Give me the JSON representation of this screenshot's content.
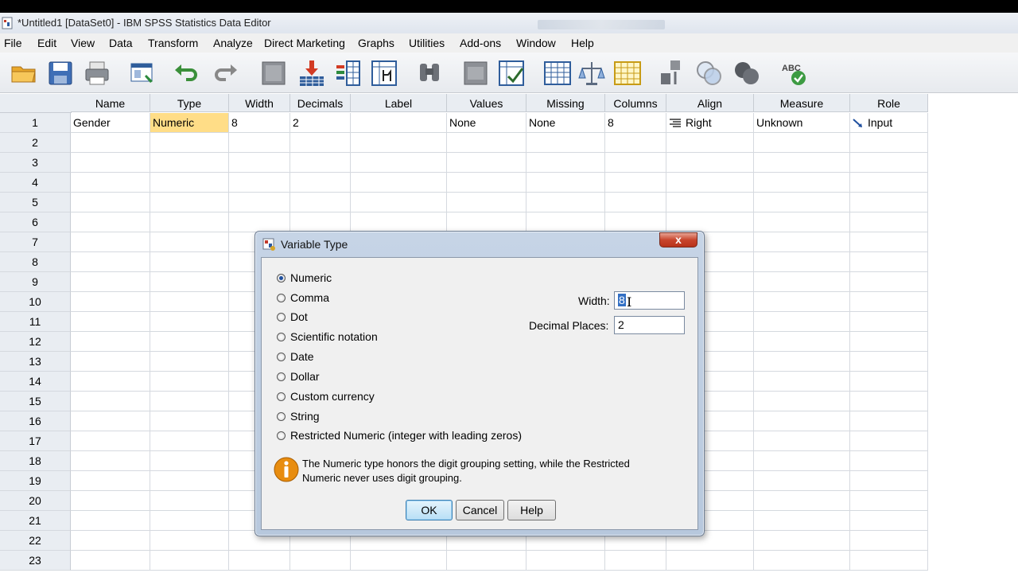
{
  "window": {
    "title": "*Untitled1 [DataSet0] - IBM SPSS Statistics Data Editor"
  },
  "menu": [
    "File",
    "Edit",
    "View",
    "Data",
    "Transform",
    "Analyze",
    "Direct Marketing",
    "Graphs",
    "Utilities",
    "Add-ons",
    "Window",
    "Help"
  ],
  "toolbar": {
    "icons": [
      "open-folder-icon",
      "save-icon",
      "print-icon",
      "dialog-recall-icon",
      "undo-icon",
      "redo-icon",
      "goto-case-icon",
      "goto-variable-icon",
      "variables-icon",
      "run-descriptives-icon",
      "find-icon",
      "insert-cases-icon",
      "insert-variable-icon",
      "split-file-icon",
      "weight-cases-icon",
      "select-cases-icon",
      "value-labels-icon",
      "use-sets-icon",
      "show-all-variables-icon",
      "spell-check-icon"
    ],
    "spell_label": "ABC"
  },
  "grid": {
    "columns": [
      "Name",
      "Type",
      "Width",
      "Decimals",
      "Label",
      "Values",
      "Missing",
      "Columns",
      "Align",
      "Measure",
      "Role"
    ],
    "rows": [
      {
        "num": "1",
        "cells": [
          "Gender",
          "Numeric",
          "8",
          "2",
          "",
          "None",
          "None",
          "8",
          "Right",
          "Unknown",
          "Input"
        ]
      }
    ],
    "row_numbers": [
      "1",
      "2",
      "3",
      "4",
      "5",
      "6",
      "7",
      "8",
      "9",
      "10",
      "11",
      "12",
      "13",
      "14",
      "15",
      "16",
      "17",
      "18",
      "19",
      "20",
      "21",
      "22",
      "23"
    ]
  },
  "dialog": {
    "title": "Variable Type",
    "close": "x",
    "types": [
      {
        "label": "Numeric",
        "selected": true
      },
      {
        "label": "Comma",
        "selected": false
      },
      {
        "label": "Dot",
        "selected": false
      },
      {
        "label": "Scientific notation",
        "selected": false
      },
      {
        "label": "Date",
        "selected": false
      },
      {
        "label": "Dollar",
        "selected": false
      },
      {
        "label": "Custom currency",
        "selected": false
      },
      {
        "label": "String",
        "selected": false
      },
      {
        "label": "Restricted Numeric (integer with leading zeros)",
        "selected": false
      }
    ],
    "width_label": "Width:",
    "width_value": "8",
    "decimals_label": "Decimal Places:",
    "decimals_value": "2",
    "info": "The Numeric type honors the digit grouping setting, while the Restricted Numeric never uses digit grouping.",
    "ok": "OK",
    "cancel": "Cancel",
    "help": "Help"
  }
}
